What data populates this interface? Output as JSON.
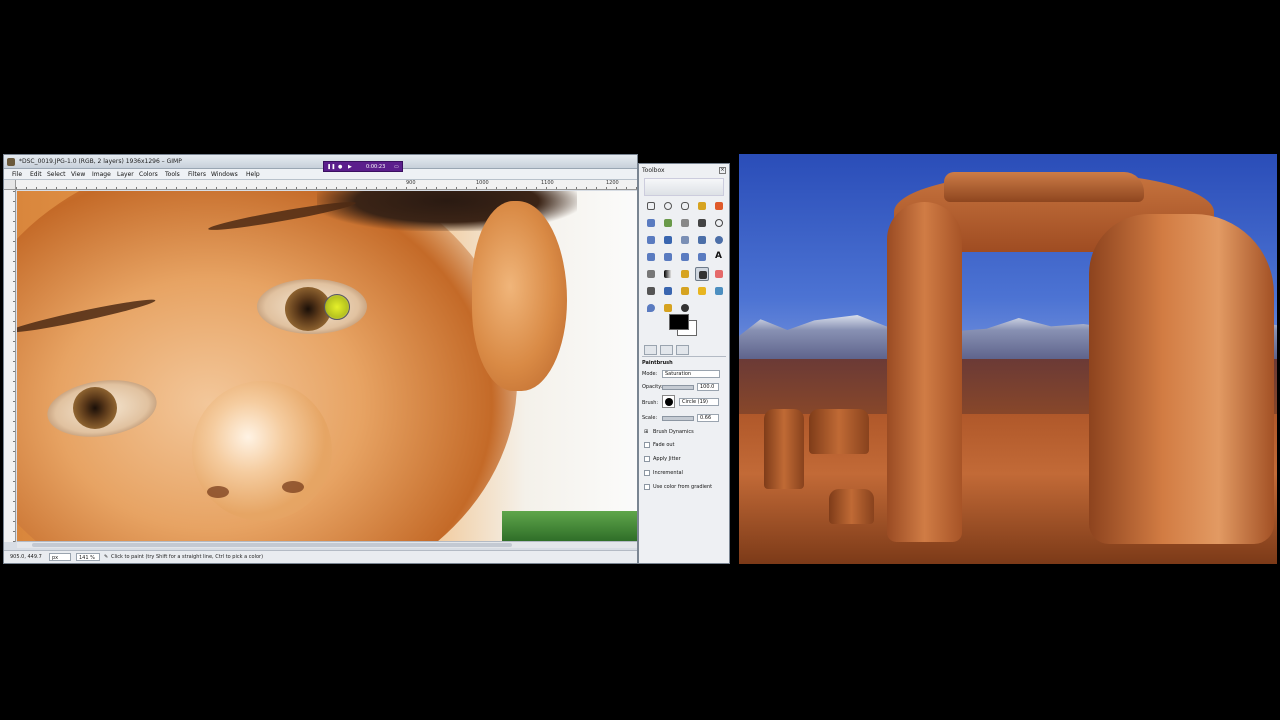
{
  "gimp_window": {
    "title": "*DSC_0019.JPG-1.0 (RGB, 2 layers) 1936x1296 – GIMP",
    "recorder_time": "0:00:23",
    "menu": [
      "File",
      "Edit",
      "Select",
      "View",
      "Image",
      "Layer",
      "Colors",
      "Tools",
      "Filters",
      "Windows",
      "Help"
    ],
    "ruler_labels": [
      "900",
      "1000",
      "1100",
      "1200"
    ],
    "status": {
      "coords": "905.0, 449.7",
      "unit": "px",
      "zoom": "141 %",
      "hint": "Click to paint (try Shift for a straight line, Ctrl to pick a color)"
    }
  },
  "toolbox": {
    "title": "Toolbox",
    "close_glyph": "×",
    "active_tool": "paintbrush",
    "fg_color": "#000000",
    "bg_color": "#ffffff",
    "tool_options": {
      "heading": "Paintbrush",
      "mode_label": "Mode:",
      "mode_value": "Saturation",
      "opacity_label": "Opacity:",
      "opacity_value": "100.0",
      "brush_label": "Brush:",
      "brush_value": "Circle (19)",
      "scale_label": "Scale:",
      "scale_value": "0.66",
      "brush_dynamics": "Brush Dynamics",
      "fade_out": "Fade out",
      "apply_jitter": "Apply Jitter",
      "incremental": "Incremental",
      "use_gradient": "Use color from gradient"
    }
  }
}
